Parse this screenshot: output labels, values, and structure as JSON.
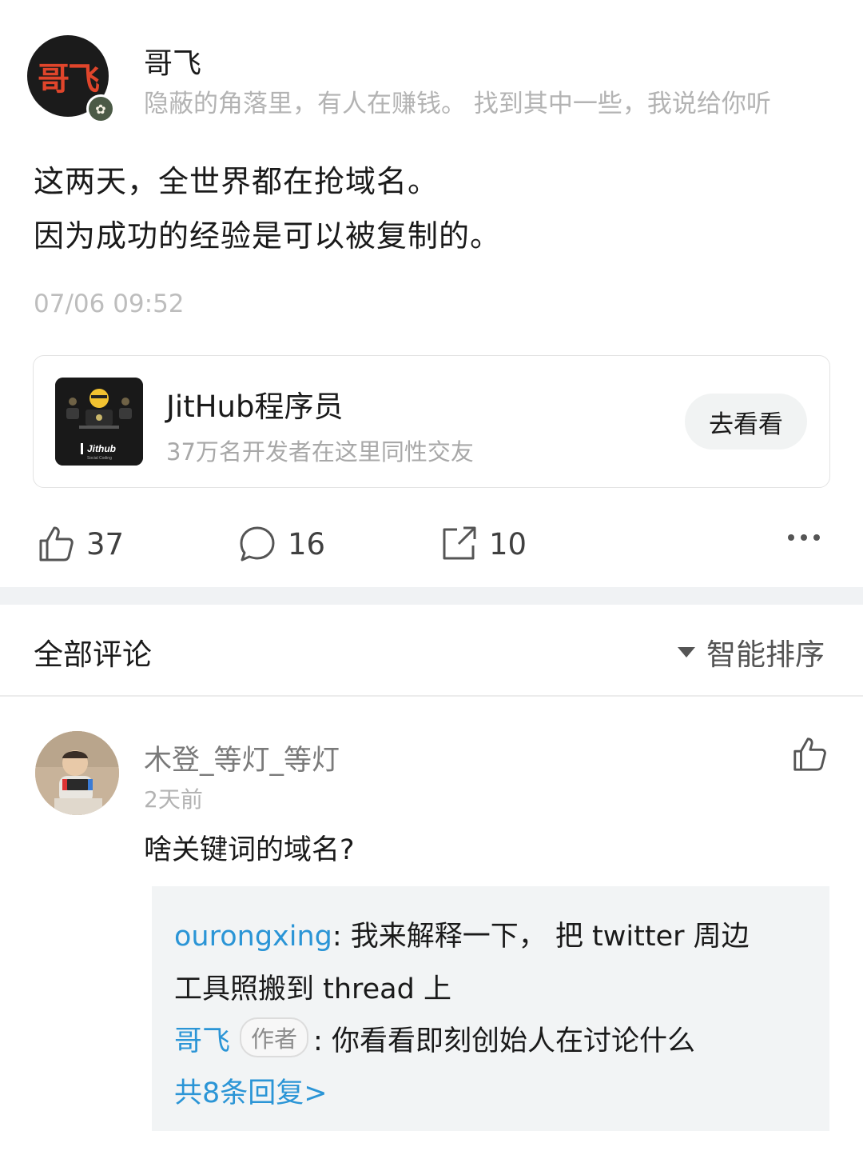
{
  "author": {
    "avatar_text": "哥飞",
    "name": "哥飞",
    "bio": "隐蔽的角落里，有人在赚钱。  找到其中一些，我说给你听"
  },
  "post": {
    "lines": [
      "这两天，全世界都在抢域名。",
      "因为成功的经验是可以被复制的。"
    ],
    "timestamp": "07/06 09:52"
  },
  "card": {
    "title": "JitHub程序员",
    "subtitle": "37万名开发者在这里同性交友",
    "button": "去看看",
    "logo_text": "Jithub",
    "logo_sub": "Social Coding"
  },
  "actions": {
    "likes": "37",
    "comments": "16",
    "shares": "10"
  },
  "comments_section": {
    "title": "全部评论",
    "sort_label": "智能排序"
  },
  "comment": {
    "user": "木登_等灯_等灯",
    "time": "2天前",
    "text": "啥关键词的域名?",
    "replies": [
      {
        "user": "ourongxing",
        "sep": ": ",
        "text1": "我来解释一下， 把 twitter 周边",
        "text2": "工具照搬到 thread 上"
      },
      {
        "user": "哥飞",
        "tag": "作者",
        "sep": ": ",
        "text1": "你看看即刻创始人在讨论什么"
      }
    ],
    "more_replies": "共8条回复>"
  },
  "colors": {
    "link": "#2b95d6",
    "divider": "#f0f2f4",
    "muted": "#b3b3b3"
  }
}
